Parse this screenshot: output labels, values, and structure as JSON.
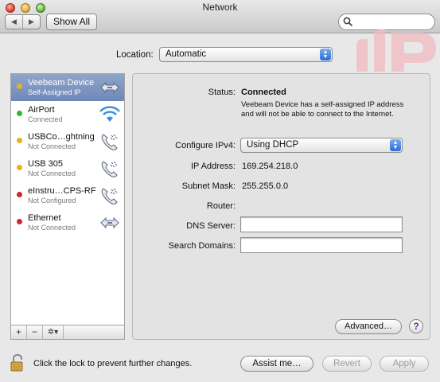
{
  "window": {
    "title": "Network"
  },
  "toolbar": {
    "back": "◀",
    "forward": "▶",
    "show_all": "Show All",
    "search_placeholder": ""
  },
  "location": {
    "label": "Location:",
    "value": "Automatic"
  },
  "services": [
    {
      "name": "Veebeam Device",
      "status": "Self-Assigned IP",
      "dot": "#e8b21d",
      "icon": "ethernet-icon",
      "selected": true
    },
    {
      "name": "AirPort",
      "status": "Connected",
      "dot": "#32b82a",
      "icon": "wifi-icon",
      "selected": false
    },
    {
      "name": "USBCo…ghtning",
      "status": "Not Connected",
      "dot": "#e8b21d",
      "icon": "phone-icon",
      "selected": false
    },
    {
      "name": "USB 305",
      "status": "Not Connected",
      "dot": "#e8b21d",
      "icon": "phone-icon",
      "selected": false
    },
    {
      "name": "eInstru…CPS-RF",
      "status": "Not Configured",
      "dot": "#d3262b",
      "icon": "phone-icon",
      "selected": false
    },
    {
      "name": "Ethernet",
      "status": "Not Connected",
      "dot": "#d3262b",
      "icon": "ethernet-icon",
      "selected": false
    }
  ],
  "sidebar_controls": {
    "add": "+",
    "remove": "−",
    "gear": "✲▾"
  },
  "detail": {
    "status_label": "Status:",
    "status_value": "Connected",
    "status_desc": "Veebeam Device has a self-assigned IP address and will not be able to connect to the Internet.",
    "configure_label": "Configure IPv4:",
    "configure_value": "Using DHCP",
    "ip_label": "IP Address:",
    "ip_value": "169.254.218.0",
    "subnet_label": "Subnet Mask:",
    "subnet_value": "255.255.0.0",
    "router_label": "Router:",
    "router_value": "",
    "dns_label": "DNS Server:",
    "dns_value": "",
    "search_domains_label": "Search Domains:",
    "search_domains_value": "",
    "advanced": "Advanced…",
    "help": "?"
  },
  "footer": {
    "lock_text": "Click the lock to prevent further changes.",
    "assist": "Assist me…",
    "revert": "Revert",
    "apply": "Apply"
  },
  "colors": {
    "accent": "#2b6cd8",
    "selection": "#7a92be",
    "purple": "#6b2aa8"
  }
}
